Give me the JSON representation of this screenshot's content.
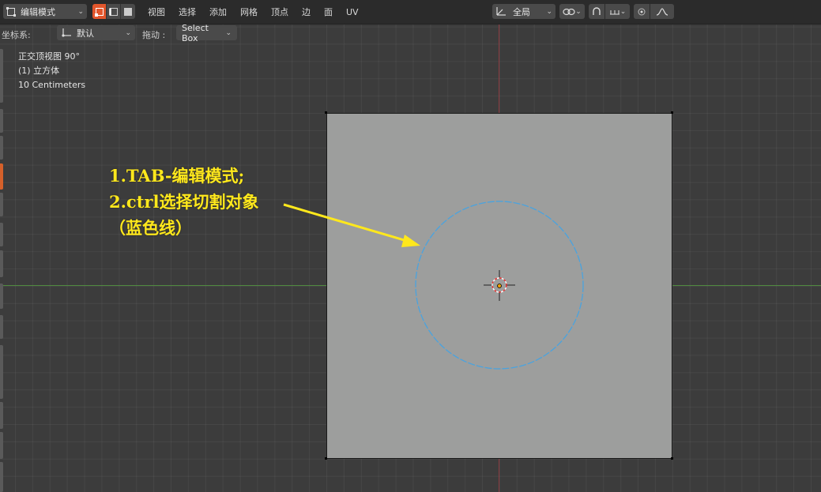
{
  "header": {
    "mode_label": "编辑模式",
    "menu": [
      "视图",
      "选择",
      "添加",
      "网格",
      "顶点",
      "边",
      "面",
      "UV"
    ],
    "pivot_label": "全局"
  },
  "tool_settings": {
    "coord_label": "坐标系:",
    "orientation_value": "默认",
    "drag_label": "拖动 :",
    "drag_value": "Select Box"
  },
  "viewport_info": {
    "view_name": "正交顶视图 90°",
    "object": "(1) 立方体",
    "scale": "10 Centimeters"
  },
  "annotation": {
    "line1": "1.TAB-编辑模式;",
    "line2": "2.ctrl选择切割对象",
    "line3": "（蓝色线）"
  },
  "colors": {
    "accent_orange": "#e2562c",
    "circle_blue": "#4aa3df",
    "annotation_yellow": "#ffe81c",
    "axis_x_green": "#4f8a3f",
    "axis_y_red": "#8a3a40"
  },
  "icons": {
    "mode": "edit-mode-icon",
    "select_vertex": "vertex-select-icon",
    "select_edge": "edge-select-icon",
    "select_face": "face-select-icon",
    "pivot": "transform-pivot-icon",
    "snap": "snap-icon",
    "proportional": "proportional-edit-icon"
  }
}
